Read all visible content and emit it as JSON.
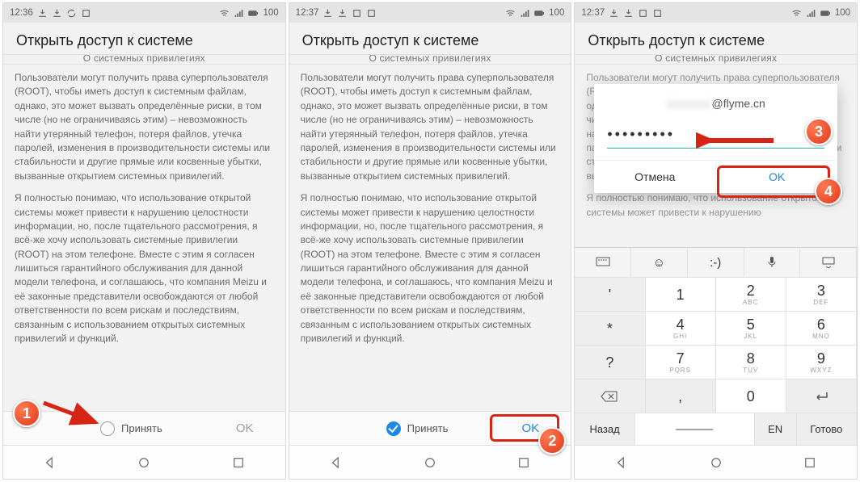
{
  "statusbar": {
    "time1": "12:36",
    "time2": "12:37",
    "time3": "12:37",
    "battery": "100"
  },
  "screen": {
    "title": "Открыть доступ к системе",
    "sliced_header": "О системных привилегиях",
    "para1": "Пользователи могут получить права суперпользователя (ROOT), чтобы иметь доступ к системным файлам, однако, это может вызвать определённые риски, в том числе (но не ограничиваясь этим) – невозможность найти утерянный телефон, потеря файлов, утечка паролей, изменения в производительности системы или стабильности и другие прямые или косвенные убытки, вызванные открытием системных привилегий.",
    "para2": "Я полностью понимаю, что использование открытой системы может привести к нарушению целостности информации, но, после тщательного рассмотрения, я всё-же хочу использовать системные привилегии (ROOT) на этом телефоне. Вместе с этим я согласен лишиться гарантийного обслуживания для данной модели телефона, и соглашаюсь, что компания Meizu и её законные представители освобождаются от любой ответственности по всем рискам и последствиям, связанным с использованием открытых системных привилегий и функций.",
    "para2_short": "Я полностью понимаю, что использование открытой системы может привести к нарушению",
    "accept": "Принять",
    "ok": "OK"
  },
  "dialog": {
    "email_hidden": "xxxxxxxx",
    "email_suffix": "@flyme.cn",
    "password_dots": "•••••••••",
    "cancel": "Отмена",
    "ok": "OK"
  },
  "keyboard": {
    "row_top": [
      "",
      "☺",
      ":-)",
      "",
      ""
    ],
    "keys": [
      {
        "main": "'",
        "sub": ""
      },
      {
        "main": "1",
        "sub": ""
      },
      {
        "main": "2",
        "sub": "ABC"
      },
      {
        "main": "3",
        "sub": "DEF"
      },
      {
        "main": "*",
        "sub": ""
      },
      {
        "main": "4",
        "sub": "GHI"
      },
      {
        "main": "5",
        "sub": "JKL"
      },
      {
        "main": "6",
        "sub": "MNO"
      },
      {
        "main": "?",
        "sub": ""
      },
      {
        "main": "7",
        "sub": "PQRS"
      },
      {
        "main": "8",
        "sub": "TUV"
      },
      {
        "main": "9",
        "sub": "WXYZ"
      }
    ],
    "bottom": {
      "back": "Назад",
      "lang": "EN",
      "done": "Готово",
      "zero": "0",
      "comma": ","
    }
  },
  "badges": {
    "b1": "1",
    "b2": "2",
    "b3": "3",
    "b4": "4"
  }
}
